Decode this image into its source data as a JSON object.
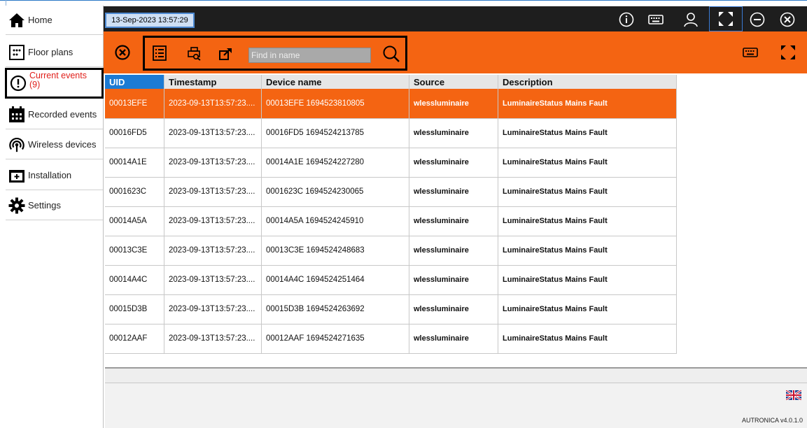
{
  "sidebar": {
    "items": [
      {
        "label": "Home",
        "icon": "home-icon"
      },
      {
        "label": "Floor plans",
        "icon": "floor-plans-icon"
      },
      {
        "label": "Current events",
        "count": "(9)",
        "icon": "alert-icon",
        "active": true
      },
      {
        "label": "Recorded events",
        "icon": "calendar-icon"
      },
      {
        "label": "Wireless devices",
        "icon": "wireless-icon"
      },
      {
        "label": "Installation",
        "icon": "installation-icon"
      },
      {
        "label": "Settings",
        "icon": "gear-icon"
      }
    ]
  },
  "topbar": {
    "datetime": "13-Sep-2023 13:57:29",
    "icons": [
      "info-icon",
      "keyboard-icon",
      "user-icon",
      "fullscreen-icon",
      "minimize-icon",
      "close-icon"
    ]
  },
  "toolbar": {
    "search_placeholder": "Find in name",
    "icons": [
      "clear-icon",
      "list-icon",
      "print-preview-icon",
      "export-icon",
      "search-icon",
      "keyboard-icon",
      "fullscreen-icon"
    ]
  },
  "table": {
    "columns": [
      "UID",
      "Timestamp",
      "Device name",
      "Source",
      "Description"
    ],
    "rows": [
      [
        "00013EFE",
        "2023-09-13T13:57:23....",
        "00013EFE 1694523810805",
        "wlessluminaire",
        "LuminaireStatus Mains Fault"
      ],
      [
        "00016FD5",
        "2023-09-13T13:57:23....",
        "00016FD5 1694524213785",
        "wlessluminaire",
        "LuminaireStatus Mains Fault"
      ],
      [
        "00014A1E",
        "2023-09-13T13:57:23....",
        "00014A1E 1694524227280",
        "wlessluminaire",
        "LuminaireStatus Mains Fault"
      ],
      [
        "0001623C",
        "2023-09-13T13:57:23....",
        "0001623C 1694524230065",
        "wlessluminaire",
        "LuminaireStatus Mains Fault"
      ],
      [
        "00014A5A",
        "2023-09-13T13:57:23....",
        "00014A5A 1694524245910",
        "wlessluminaire",
        "LuminaireStatus Mains Fault"
      ],
      [
        "00013C3E",
        "2023-09-13T13:57:23....",
        "00013C3E 1694524248683",
        "wlessluminaire",
        "LuminaireStatus Mains Fault"
      ],
      [
        "00014A4C",
        "2023-09-13T13:57:23....",
        "00014A4C 1694524251464",
        "wlessluminaire",
        "LuminaireStatus Mains Fault"
      ],
      [
        "00015D3B",
        "2023-09-13T13:57:23....",
        "00015D3B 1694524263692",
        "wlessluminaire",
        "LuminaireStatus Mains Fault"
      ],
      [
        "00012AAF",
        "2023-09-13T13:57:23....",
        "00012AAF 1694524271635",
        "wlessluminaire",
        "LuminaireStatus Mains Fault"
      ]
    ]
  },
  "footer": {
    "version": "AUTRONICA v4.0.1.0",
    "language_icon": "uk-flag-icon"
  },
  "colors": {
    "accent": "#f46412",
    "topbar": "#1e1e1e",
    "selected_header": "#1c7bd4",
    "alert_text": "#e0201b"
  }
}
